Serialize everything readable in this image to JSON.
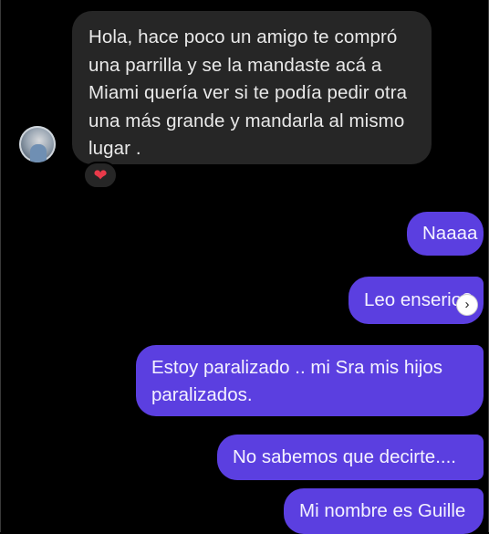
{
  "incoming_message": {
    "text": "Hola, hace poco un amigo te compró una parrilla y se la mandaste acá a Miami quería ver si te podía pedir otra una más grande y mandarla al mismo lugar .",
    "reaction": "❤"
  },
  "outgoing_messages": [
    {
      "text": "Naaaa"
    },
    {
      "text": "Leo enserio?"
    },
    {
      "text": "Estoy paralizado .. mi Sra mis hijos paralizados."
    },
    {
      "text": "No sabemos que decirte...."
    },
    {
      "text": "Mi nombre es Guille"
    }
  ],
  "icons": {
    "avatar": "profile-photo",
    "reaction": "heart-icon",
    "scroll": "chevron-right-icon"
  }
}
